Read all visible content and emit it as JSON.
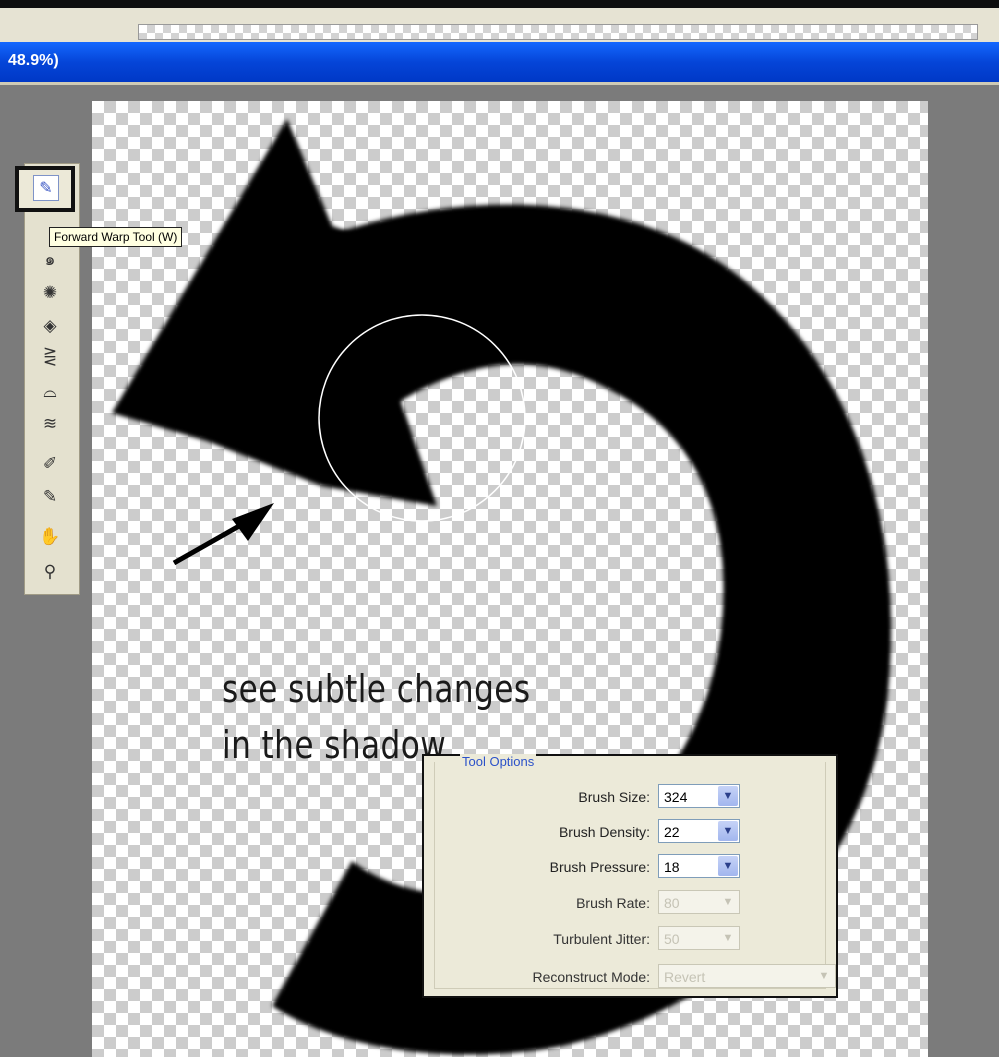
{
  "window": {
    "title": "48.9%)"
  },
  "toolbar": {
    "tooltip": "Forward Warp Tool (W)",
    "tools": [
      {
        "name": "forward-warp-tool",
        "icon": "forward-warp-icon",
        "glyph": "✎",
        "selected": true
      },
      {
        "name": "twirl-tool",
        "icon": "twirl-icon",
        "glyph": "@"
      },
      {
        "name": "pucker-tool",
        "icon": "pucker-icon",
        "glyph": "✺"
      },
      {
        "name": "bloat-tool",
        "icon": "bloat-icon",
        "glyph": "◇"
      },
      {
        "name": "push-left-tool",
        "icon": "push-left-icon",
        "glyph": "⋛"
      },
      {
        "name": "mirror-tool",
        "icon": "mirror-icon",
        "glyph": "⌓"
      },
      {
        "name": "turbulence-tool",
        "icon": "turbulence-icon",
        "glyph": "≋"
      },
      {
        "name": "freeze-mask-tool",
        "icon": "freeze-mask-icon",
        "glyph": "✐"
      },
      {
        "name": "thaw-mask-tool",
        "icon": "thaw-mask-icon",
        "glyph": "✎"
      },
      {
        "name": "hand-tool",
        "icon": "hand-icon",
        "glyph": "☚"
      },
      {
        "name": "zoom-tool",
        "icon": "zoom-icon",
        "glyph": "⚲"
      }
    ]
  },
  "annotation": {
    "line1": "see subtle changes",
    "line2": "in the shadow"
  },
  "tool_options": {
    "legend": "Tool Options",
    "brush_size": {
      "label": "Brush Size:",
      "value": "324"
    },
    "brush_density": {
      "label": "Brush Density:",
      "value": "22"
    },
    "brush_pressure": {
      "label": "Brush Pressure:",
      "value": "18"
    },
    "brush_rate": {
      "label": "Brush Rate:",
      "value": "80"
    },
    "turbulent_jitter": {
      "label": "Turbulent Jitter:",
      "value": "50"
    },
    "reconstruct_mode": {
      "label": "Reconstruct Mode:",
      "value": "Revert"
    }
  }
}
